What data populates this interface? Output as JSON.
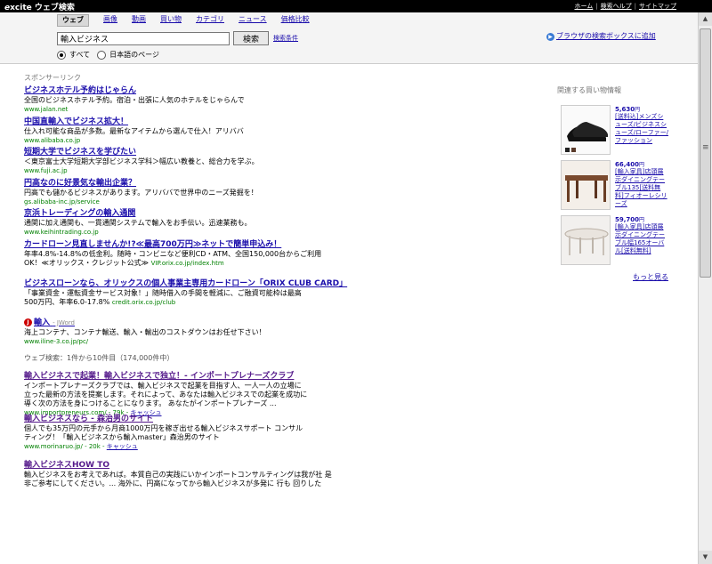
{
  "topbar": {
    "logo_e": "e",
    "logo_rest": "xcite ウェブ検索",
    "links": [
      "ホーム",
      "検索ヘルプ",
      "サイトマップ"
    ]
  },
  "tabs": [
    {
      "label": "ウェブ",
      "active": true
    },
    {
      "label": "画像",
      "active": false
    },
    {
      "label": "動画",
      "active": false
    },
    {
      "label": "買い物",
      "active": false
    },
    {
      "label": "カテゴリ",
      "active": false
    },
    {
      "label": "ニュース",
      "active": false
    },
    {
      "label": "価格比較",
      "active": false
    }
  ],
  "search": {
    "value": "輸入ビジネス",
    "button": "検索",
    "options_link": "検索条件",
    "browser_link": "ブラウザの検索ボックスに追加",
    "browser_arrow": "▶",
    "radio_all": "すべて",
    "radio_ja": "日本語のページ"
  },
  "sponsor_header": "スポンサーリンク",
  "ads": [
    {
      "title": "ビジネスホテル予約はじゃらん",
      "desc": "全国のビジネスホテル予約。宿泊・出張に人気のホテルをじゃらんで",
      "url": "www.jalan.net"
    },
    {
      "title": "中国直輸入でビジネス拡大！",
      "desc": "仕入れ可能な商品が多数。最新なアイテムから選んで仕入！アリババ",
      "url": "www.alibaba.co.jp"
    },
    {
      "title": "短期大学でビジネスを学びたい",
      "desc": "＜東京富士大学短期大学部ビジネス学科＞幅広い教養と、総合力を学ぶ。",
      "url": "www.fuji.ac.jp"
    },
    {
      "title": "円高なのに好景気な輸出企業？",
      "desc": "円高でも儲かるビジネスがあります。アリババで世界中のニーズ発掘を！",
      "url": "gs.alibaba-inc.jp/service"
    },
    {
      "title": "京浜トレーディングの輸入通関",
      "desc": "通関に加え通関も、一貫通関システムで輸入をお手伝い。迅速業務も。",
      "url": "www.keihintrading.co.jp"
    },
    {
      "title": "カードローン見直しませんか!?≪最高700万円≫ネットで簡単申込み！",
      "desc": "年率4.8%-14.8%の低金利。随時・コンビニなど便利CD・ATM、全国150,000台からご利用",
      "desc2": "OK！≪オリックス・クレジット公式≫",
      "url": "VIP.orix.co.jp/index.htm",
      "long": true
    },
    {
      "title": "ビジネスローンなら、オリックスの個人事業主専用カードローン「ORIX CLUB CARD」",
      "desc": "「事業資金・運転資金サービス対象！」随時借入の手間を軽減に、ご融資可能枠は最高",
      "desc2": "500万円、年率6.0-17.8%",
      "url": "credit.orix.co.jp/club",
      "long": true
    },
    {
      "title": "輸入",
      "jw_icon": "J",
      "jw_label": "- JWord",
      "desc": "海上コンテナ、コンテナ輸送、輸入・輸出のコストダウンはお任せ下さい！",
      "url": "www.iline-3.co.jp/pc/"
    }
  ],
  "web_header": "ウェブ検索：1件から10件目（174,000件中）",
  "results": [
    {
      "title": "輸入ビジネスで起業！輸入ビジネスで独立！- インポートプレナーズクラブ",
      "lines": [
        "インポートプレナーズクラブでは、輸入ビジネスで起業を目指す人、一人一人の立場に",
        "立った最新の方法を提案します。それによって、あなたは輸入ビジネスでの起業を成功に",
        "導く次の方法を身につけることになります。 あなたがインポートプレナーズ ..."
      ],
      "url": "www.importpreneurs.com/ - 79k - ",
      "cache": "キャッシュ"
    },
    {
      "title": "輸入ビジネスなら - 森治男のサイト",
      "lines": [
        "個人でも35万円の元手から月商1000万円を稼ぎ出せる輸入ビジネスサポート コンサル",
        "ティング！「輸入ビジネスから輸入master」森治男のサイト"
      ],
      "url": "www.morinaruo.jp/ - 20k - ",
      "cache": "キャッシュ"
    },
    {
      "title": "輸入ビジネスHOW TO",
      "lines": [
        "輸入ビジネスをお考えであれば。本質自己の実践にいかインポートコンサルティングは我が社 是",
        "非ご参考にしてください。... 海外に、円高になってから輸入ビジネスが多発に 行も 回りした"
      ],
      "url": "",
      "cache": ""
    }
  ],
  "sidebar": {
    "header": "関連する買い物情報",
    "products": [
      {
        "price": "5,630",
        "yen": "円",
        "name": "[送料込]メンズシューズ/ビジネスシューズ/ローファー/ファッション"
      },
      {
        "price": "66,400",
        "yen": "円",
        "name": "[輸入家具]店頭展示ダイニングテーブル135[送料無料]フィオーレシリーズ"
      },
      {
        "price": "59,700",
        "yen": "円",
        "name": "[輸入家具]店頭展示ダイニングテーブル幅165オーバル[送料無料]"
      }
    ],
    "more": "もっと見る"
  },
  "scrollbar": {
    "up": "▲",
    "down": "▼"
  }
}
